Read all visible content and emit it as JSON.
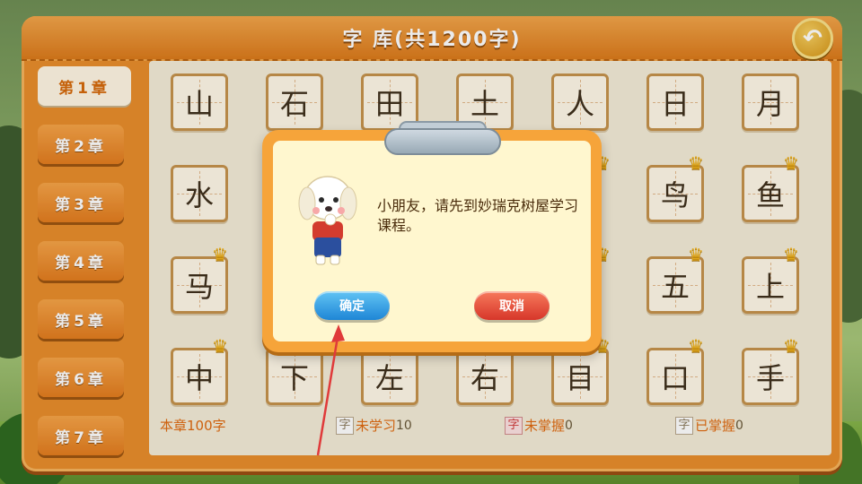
{
  "header": {
    "title": "字 库(共1200字)"
  },
  "back_button": {
    "icon": "back-arrow-icon",
    "glyph": "↶"
  },
  "sidebar": {
    "chapters": [
      {
        "label": "第1章",
        "active": true
      },
      {
        "label": "第2章",
        "active": false
      },
      {
        "label": "第3章",
        "active": false
      },
      {
        "label": "第4章",
        "active": false
      },
      {
        "label": "第5章",
        "active": false
      },
      {
        "label": "第6章",
        "active": false
      },
      {
        "label": "第7章",
        "active": false
      }
    ]
  },
  "grid": {
    "rows": [
      [
        "山",
        "石",
        "田",
        "土",
        "人",
        "日",
        "月"
      ],
      [
        "水",
        "",
        "",
        "",
        "",
        "鸟",
        "鱼"
      ],
      [
        "马",
        "",
        "",
        "",
        "",
        "五",
        "上"
      ],
      [
        "中",
        "下",
        "左",
        "右",
        "目",
        "口",
        "手"
      ]
    ]
  },
  "stats": {
    "total": "本章100字",
    "not_learned": {
      "box": "字",
      "label": "未学习",
      "count": "10"
    },
    "not_mastered": {
      "box": "字",
      "label": "未掌握",
      "count": "0"
    },
    "mastered": {
      "box": "字",
      "label": "已掌握",
      "count": "0"
    }
  },
  "dialog": {
    "message": "小朋友，请先到妙瑞克树屋学习课程。",
    "ok_label": "确定",
    "cancel_label": "取消"
  },
  "colors": {
    "board": "#e98e2c",
    "ok_button": "#1e86d6",
    "cancel_button": "#d7362a",
    "annotation_arrow": "#e03a3a"
  }
}
